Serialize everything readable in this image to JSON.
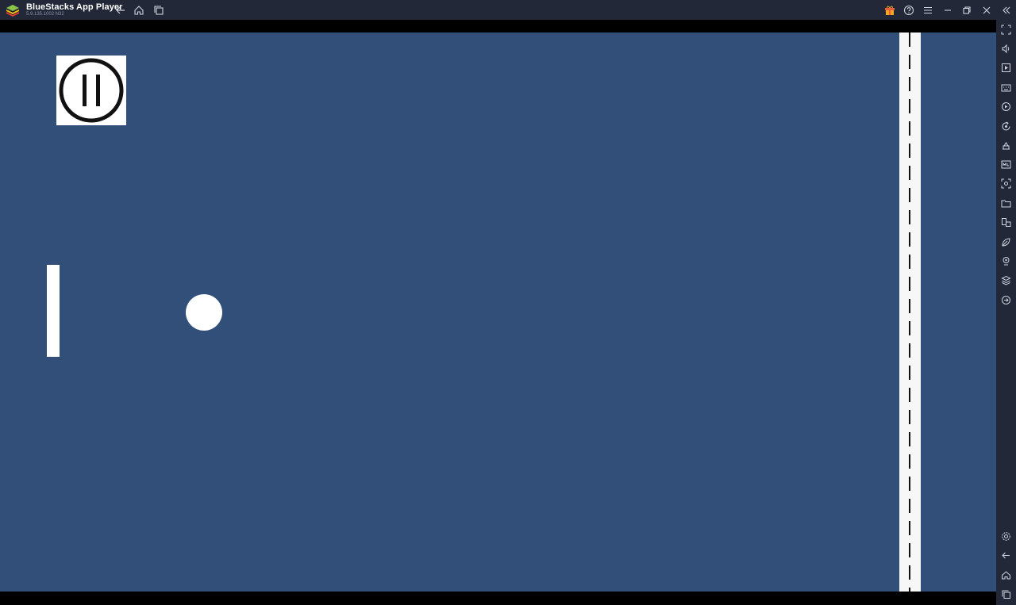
{
  "window": {
    "title": "BlueStacks App Player",
    "version": "5.9.135.1002 N32",
    "buttons": [
      "back-icon",
      "home-icon",
      "recent-apps-icon",
      "gift-icon",
      "help-icon",
      "menu-icon",
      "minimize-icon",
      "restore-icon",
      "close-icon",
      "collapse-sidebar-icon"
    ]
  },
  "game": {
    "background_color": "#324f7a",
    "pause_button": "pause-icon",
    "paddle_color": "#ffffff",
    "ball_color": "#ffffff"
  },
  "sidebar": {
    "top_icons": [
      "fullscreen-icon",
      "volume-icon",
      "media-icon",
      "keyboard-controls-icon",
      "record-icon",
      "rotate-icon",
      "install-apk-icon",
      "macro-icon",
      "screenshot-icon",
      "folder-icon",
      "multi-instance-icon",
      "eco-mode-icon",
      "location-icon",
      "layers-icon",
      "sync-icon"
    ],
    "bottom_icons": [
      "settings-icon",
      "back-icon",
      "home-icon",
      "recent-apps-icon"
    ]
  }
}
